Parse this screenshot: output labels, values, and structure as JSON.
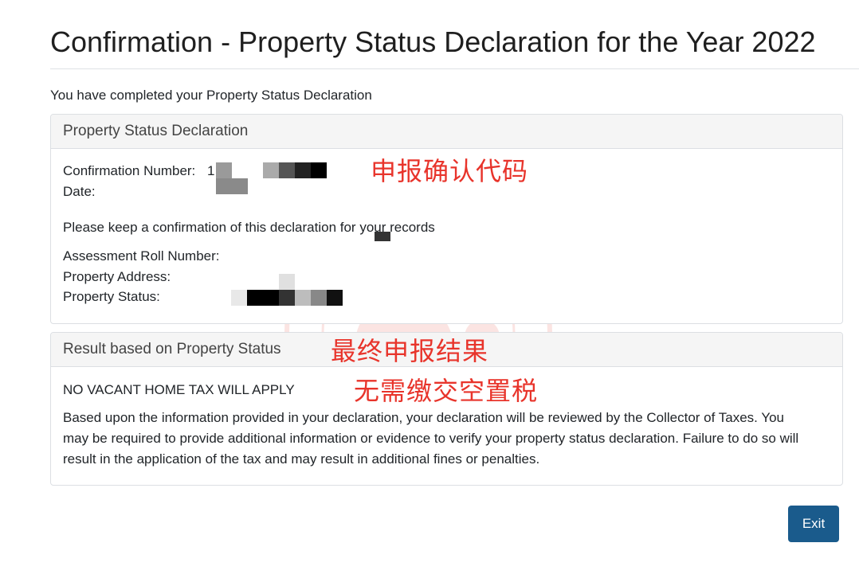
{
  "page": {
    "title": "Confirmation - Property Status Declaration for the Year 2022",
    "intro": "You have completed your Property Status Declaration"
  },
  "declaration_card": {
    "header": "Property Status Declaration",
    "confirmation_number_label": "Confirmation Number:",
    "confirmation_number_prefix": "1",
    "date_label": "Date:",
    "keep_note": "Please keep a confirmation of this declaration for your records",
    "assessment_roll_label": "Assessment Roll Number:",
    "property_address_label": "Property Address:",
    "property_status_label": "Property Status:"
  },
  "result_card": {
    "header": "Result based on Property Status",
    "result": "NO VACANT HOME TAX WILL APPLY",
    "paragraph": "Based upon the information provided in your declaration, your declaration will be reviewed by the Collector of Taxes. You may be required to provide additional information or evidence to verify your property status declaration. Failure to do so will result in the application of the tax and may result in additional fines or penalties."
  },
  "annotations": {
    "confirmation_code": "申报确认代码",
    "final_result": "最终申报结果",
    "no_tax": "无需缴交空置税"
  },
  "watermark": {
    "text": "TAMOMCLUB",
    "text_cn": "多妈妈"
  },
  "actions": {
    "exit_label": "Exit"
  },
  "colors": {
    "exit_button": "#1a5b8c",
    "annotation": "#e8342b",
    "card_header_bg": "#f5f5f5"
  }
}
